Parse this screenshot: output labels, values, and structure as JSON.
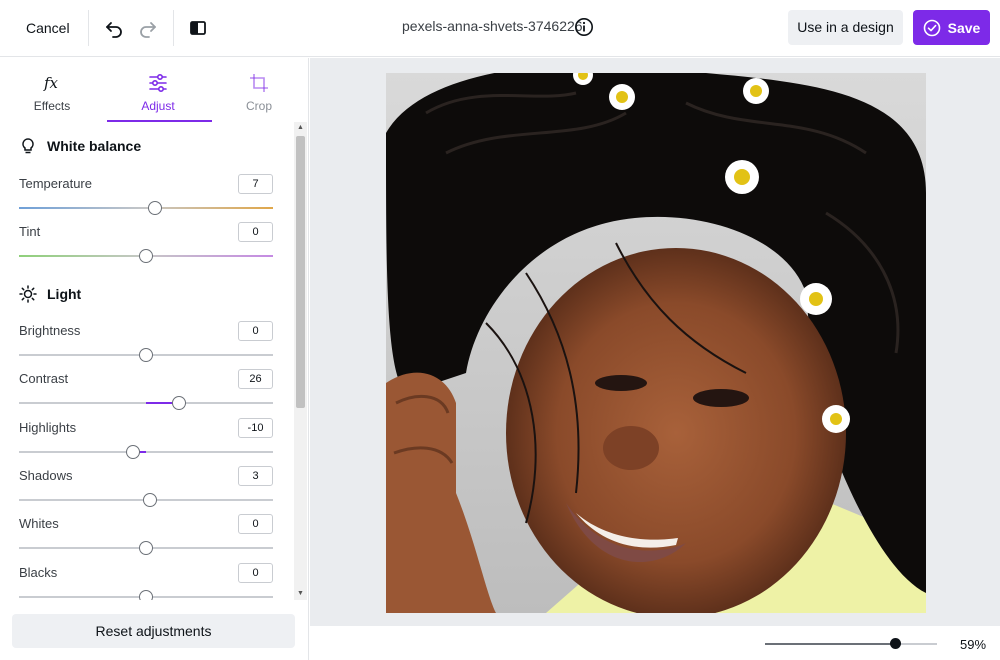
{
  "toolbar": {
    "cancel_label": "Cancel",
    "file_title": "pexels-anna-shvets-3746226",
    "use_in_design_label": "Use in a design",
    "save_label": "Save",
    "accent_color": "#7d2ae8"
  },
  "tabs": [
    {
      "label": "Effects",
      "icon": "fx-icon",
      "active": false
    },
    {
      "label": "Adjust",
      "icon": "sliders-icon",
      "active": true
    },
    {
      "label": "Crop",
      "icon": "crop-icon",
      "active": false
    }
  ],
  "white_balance": {
    "title": "White balance",
    "icon": "lightbulb-icon",
    "sliders": [
      {
        "label": "Temperature",
        "value": "7",
        "level": 7
      },
      {
        "label": "Tint",
        "value": "0",
        "level": 0
      }
    ]
  },
  "light": {
    "title": "Light",
    "icon": "sun-icon",
    "sliders": [
      {
        "label": "Brightness",
        "value": "0",
        "level": 0
      },
      {
        "label": "Contrast",
        "value": "26",
        "level": 26
      },
      {
        "label": "Highlights",
        "value": "-10",
        "level": -10
      },
      {
        "label": "Shadows",
        "value": "3",
        "level": 3
      },
      {
        "label": "Whites",
        "value": "0",
        "level": 0
      },
      {
        "label": "Blacks",
        "value": "0",
        "level": 0
      }
    ]
  },
  "reset_label": "Reset adjustments",
  "zoom": {
    "label": "59%",
    "level": 59
  }
}
